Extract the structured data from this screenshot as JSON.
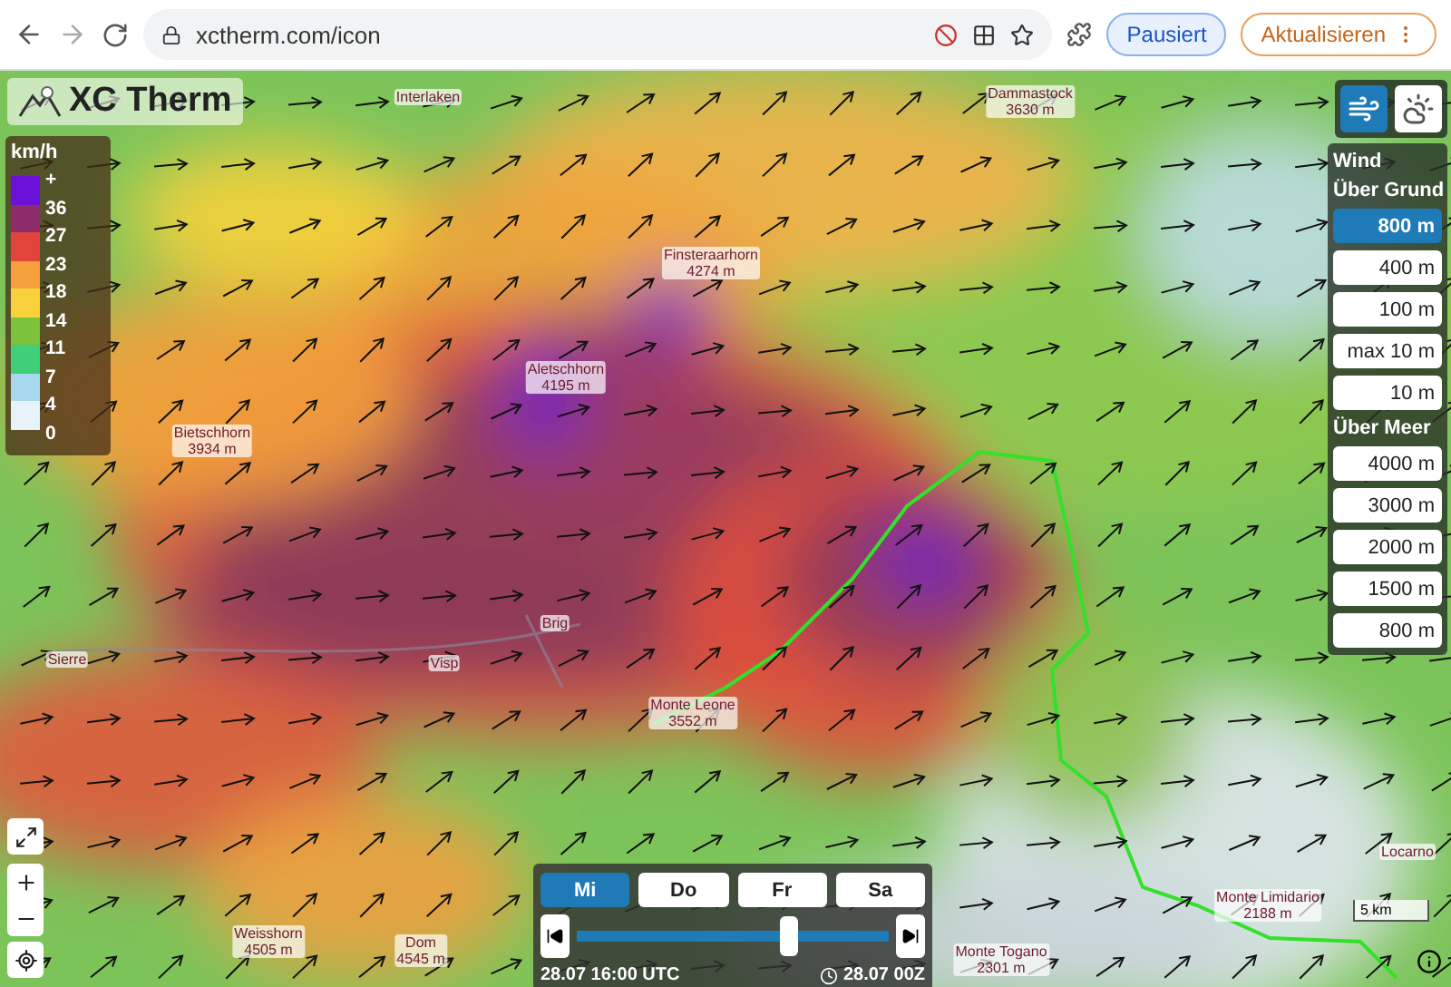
{
  "browser": {
    "url": "xctherm.com/icon",
    "profile_button": "Pausiert",
    "update_button": "Aktualisieren"
  },
  "logo": "XC Therm",
  "legend": {
    "unit": "km/h",
    "labels": [
      "+",
      "36",
      "27",
      "23",
      "18",
      "14",
      "11",
      "7",
      "4",
      "0"
    ],
    "swatches": [
      {
        "color": "#6a10d8"
      },
      {
        "color": "#8e2b6b"
      },
      {
        "color": "#e0443a"
      },
      {
        "color": "#f5a03c"
      },
      {
        "color": "#f8d13c"
      },
      {
        "color": "#7cc23a"
      },
      {
        "color": "#3fcf7a"
      },
      {
        "color": "#a8d8ee"
      },
      {
        "color": "#e8f2fa"
      }
    ]
  },
  "mode_buttons": [
    {
      "kind": "wind",
      "selected": true
    },
    {
      "kind": "clouds",
      "selected": false
    }
  ],
  "wind_panel": {
    "title": "Wind",
    "groups": [
      {
        "heading": "Über Grund",
        "levels": [
          {
            "label": "800 m",
            "selected": true
          },
          {
            "label": "400 m",
            "selected": false
          },
          {
            "label": "100 m",
            "selected": false
          },
          {
            "label": "max 10 m",
            "selected": false
          },
          {
            "label": "10 m",
            "selected": false
          }
        ]
      },
      {
        "heading": "Über Meer",
        "levels": [
          {
            "label": "4000 m",
            "selected": false
          },
          {
            "label": "3000 m",
            "selected": false
          },
          {
            "label": "2000 m",
            "selected": false
          },
          {
            "label": "1500 m",
            "selected": false
          },
          {
            "label": "800 m",
            "selected": false
          }
        ]
      }
    ]
  },
  "map_labels": [
    {
      "name": "Interlaken"
    },
    {
      "name": "Dammastock",
      "elevation": "3630 m"
    },
    {
      "name": "Finsteraarhorn",
      "elevation": "4274 m"
    },
    {
      "name": "Aletschhorn",
      "elevation": "4195 m"
    },
    {
      "name": "Bietschhorn",
      "elevation": "3934 m"
    },
    {
      "name": "Brig"
    },
    {
      "name": "Visp"
    },
    {
      "name": "Sierre"
    },
    {
      "name": "Monte Leone",
      "elevation": "3552 m"
    },
    {
      "name": "Weisshorn",
      "elevation": "4505 m"
    },
    {
      "name": "Dom",
      "elevation": "4545 m"
    },
    {
      "name": "Monte Togano",
      "elevation": "2301 m"
    },
    {
      "name": "Monte Limidario",
      "elevation": "2188 m"
    },
    {
      "name": "Locarno"
    }
  ],
  "timeline": {
    "days": [
      {
        "label": "Mi",
        "selected": true
      },
      {
        "label": "Do",
        "selected": false
      },
      {
        "label": "Fr",
        "selected": false
      },
      {
        "label": "Sa",
        "selected": false
      }
    ],
    "level": 0.68,
    "current_time": "28.07 16:00 UTC",
    "run_time": "28.07 00Z"
  },
  "scale": "5 km"
}
